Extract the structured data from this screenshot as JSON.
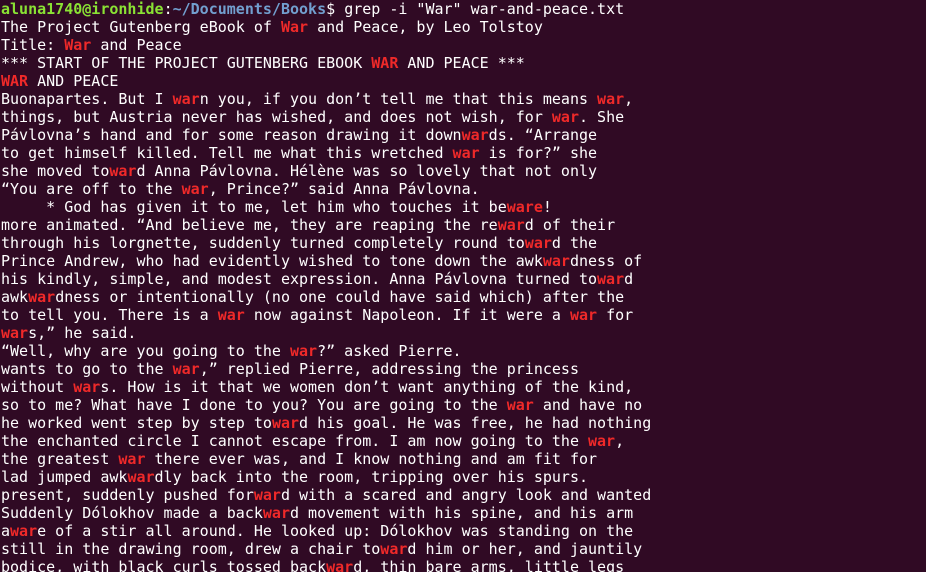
{
  "prompt": {
    "user_host": "aluna1740@ironhide",
    "separator": ":",
    "path": "~/Documents/Books",
    "symbol": "$ ",
    "command": "grep -i \"War\" war-and-peace.txt"
  },
  "colors": {
    "background": "#300a24",
    "text": "#ffffff",
    "user_host": "#8ae234",
    "path": "#729fcf",
    "match": "#ef2929"
  },
  "output": [
    [
      "The Project Gutenberg eBook of ",
      {
        "m": "War"
      },
      " and Peace, by Leo Tolstoy"
    ],
    [
      "Title: ",
      {
        "m": "War"
      },
      " and Peace"
    ],
    [
      "*** START OF THE PROJECT GUTENBERG EBOOK ",
      {
        "m": "WAR"
      },
      " AND PEACE ***"
    ],
    [
      {
        "m": "WAR"
      },
      " AND PEACE"
    ],
    [
      "Buonapartes. But I ",
      {
        "m": "war"
      },
      "n you, if you don’t tell me that this means ",
      {
        "m": "war"
      },
      ","
    ],
    [
      "things, but Austria never has wished, and does not wish, for ",
      {
        "m": "war"
      },
      ". She"
    ],
    [
      "Pávlovna’s hand and for some reason drawing it down",
      {
        "m": "war"
      },
      "ds. “Arrange"
    ],
    [
      "to get himself killed. Tell me what this wretched ",
      {
        "m": "war"
      },
      " is for?” she"
    ],
    [
      "she moved to",
      {
        "m": "war"
      },
      "d Anna Pávlovna. Hélène was so lovely that not only"
    ],
    [
      "“You are off to the ",
      {
        "m": "war"
      },
      ", Prince?” said Anna Pávlovna."
    ],
    [
      "     * God has given it to me, let him who touches it be",
      {
        "m": "ware"
      },
      "!"
    ],
    [
      "more animated. “And believe me, they are reaping the re",
      {
        "m": "war"
      },
      "d of their"
    ],
    [
      "through his lorgnette, suddenly turned completely round to",
      {
        "m": "war"
      },
      "d the"
    ],
    [
      "Prince Andrew, who had evidently wished to tone down the awk",
      {
        "m": "war"
      },
      "dness of"
    ],
    [
      "his kindly, simple, and modest expression. Anna Pávlovna turned to",
      {
        "m": "war"
      },
      "d"
    ],
    [
      "awk",
      {
        "m": "war"
      },
      "dness or intentionally (no one could have said which) after the"
    ],
    [
      "to tell you. There is a ",
      {
        "m": "war"
      },
      " now against Napoleon. If it were a ",
      {
        "m": "war"
      },
      " for"
    ],
    [
      {
        "m": "war"
      },
      "s,” he said."
    ],
    [
      "“Well, why are you going to the ",
      {
        "m": "war"
      },
      "?” asked Pierre."
    ],
    [
      "wants to go to the ",
      {
        "m": "war"
      },
      ",” replied Pierre, addressing the princess"
    ],
    [
      "without ",
      {
        "m": "war"
      },
      "s. How is it that we women don’t want anything of the kind,"
    ],
    [
      "so to me? What have I done to you? You are going to the ",
      {
        "m": "war"
      },
      " and have no"
    ],
    [
      "he worked went step by step to",
      {
        "m": "war"
      },
      "d his goal. He was free, he had nothing"
    ],
    [
      "the enchanted circle I cannot escape from. I am now going to the ",
      {
        "m": "war"
      },
      ","
    ],
    [
      "the greatest ",
      {
        "m": "war"
      },
      " there ever was, and I know nothing and am fit for"
    ],
    [
      "lad jumped awk",
      {
        "m": "war"
      },
      "dly back into the room, tripping over his spurs."
    ],
    [
      "present, suddenly pushed for",
      {
        "m": "war"
      },
      "d with a scared and angry look and wanted"
    ],
    [
      "Suddenly Dólokhov made a back",
      {
        "m": "war"
      },
      "d movement with his spine, and his arm"
    ],
    [
      "a",
      {
        "m": "war"
      },
      "e of a stir all around. He looked up: Dólokhov was standing on the"
    ],
    [
      "still in the drawing room, drew a chair to",
      {
        "m": "war"
      },
      "d him or her, and jauntily"
    ],
    [
      "bodice, with black curls tossed back",
      {
        "m": "war"
      },
      "d, thin bare arms, little legs"
    ]
  ]
}
